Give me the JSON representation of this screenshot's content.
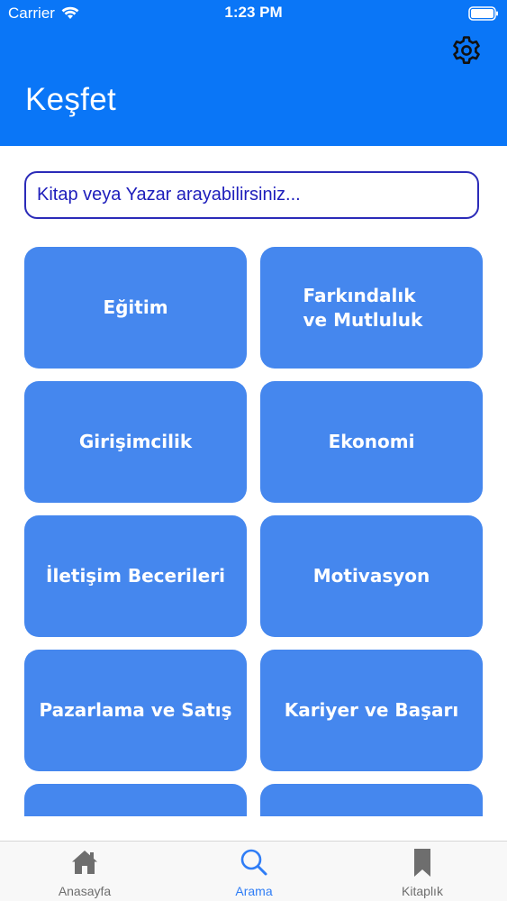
{
  "status_bar": {
    "carrier": "Carrier",
    "time": "1:23 PM"
  },
  "header": {
    "title": "Keşfet",
    "settings_icon": "gear-icon"
  },
  "search": {
    "placeholder": "Kitap veya Yazar arayabilirsiniz...",
    "value": ""
  },
  "categories": [
    {
      "label": "Eğitim"
    },
    {
      "label": "Farkındalık ve Mutluluk"
    },
    {
      "label": "Girişimcilik"
    },
    {
      "label": "Ekonomi"
    },
    {
      "label": "İletişim Becerileri"
    },
    {
      "label": "Motivasyon"
    },
    {
      "label": "Pazarlama ve Satış"
    },
    {
      "label": "Kariyer ve Başarı"
    },
    {
      "label": ""
    },
    {
      "label": ""
    }
  ],
  "tab_bar": {
    "items": [
      {
        "label": "Anasayfa",
        "icon": "home-icon",
        "active": false
      },
      {
        "label": "Arama",
        "icon": "search-icon",
        "active": true
      },
      {
        "label": "Kitaplık",
        "icon": "bookmark-icon",
        "active": false
      }
    ]
  },
  "colors": {
    "header_bg": "#0a76f7",
    "card_bg": "#4587ee",
    "search_border": "#2b2bb8",
    "search_text": "#1d1dbb",
    "tab_active": "#2f7df6",
    "tab_inactive": "#6e6e6e"
  }
}
